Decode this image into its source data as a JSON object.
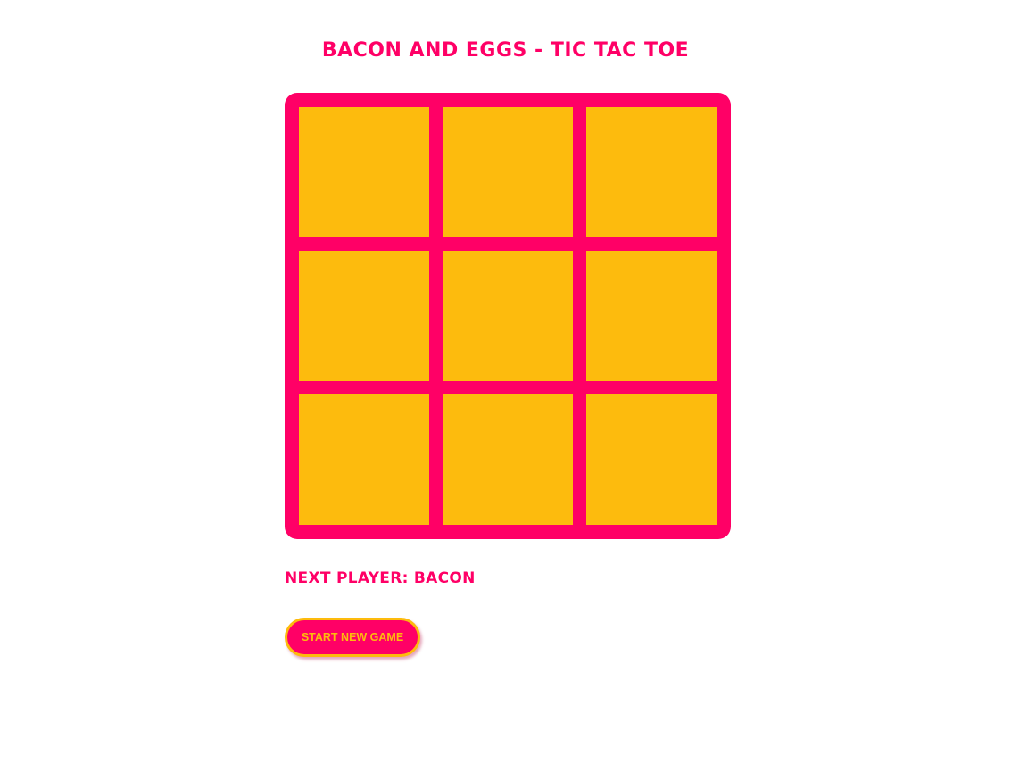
{
  "page": {
    "title": "BACON AND EGGS - TIC TAC TOE"
  },
  "board": {
    "cells": [
      "",
      "",
      "",
      "",
      "",
      "",
      "",
      "",
      ""
    ]
  },
  "status": {
    "text": "NEXT PLAYER: BACON"
  },
  "controls": {
    "new_game_label": "START NEW GAME"
  },
  "colors": {
    "accent": "#ff0066",
    "cell": "#fdbb0d",
    "background": "#ffffff"
  }
}
